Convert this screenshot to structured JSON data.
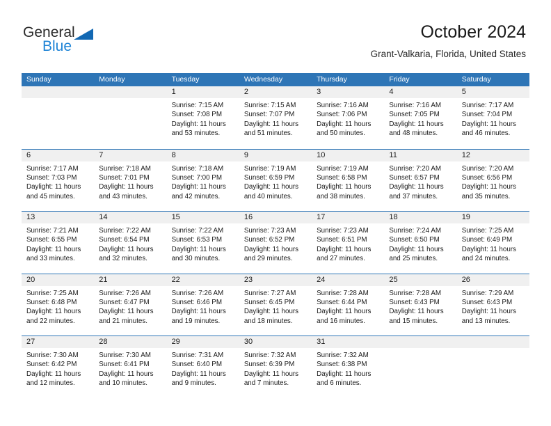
{
  "brand": {
    "name_top": "General",
    "name_bottom": "Blue",
    "accent_color": "#1f84d6",
    "triangle_color": "#1268b3"
  },
  "header": {
    "title": "October 2024",
    "subtitle": "Grant-Valkaria, Florida, United States"
  },
  "calendar": {
    "header_bg": "#2e75b6",
    "daynum_bg": "#f0f0f0",
    "weekdays": [
      "Sunday",
      "Monday",
      "Tuesday",
      "Wednesday",
      "Thursday",
      "Friday",
      "Saturday"
    ],
    "weeks": [
      [
        {
          "day": "",
          "empty": true,
          "lines": []
        },
        {
          "day": "",
          "empty": true,
          "lines": []
        },
        {
          "day": "1",
          "lines": [
            "Sunrise: 7:15 AM",
            "Sunset: 7:08 PM",
            "Daylight: 11 hours",
            "and 53 minutes."
          ]
        },
        {
          "day": "2",
          "lines": [
            "Sunrise: 7:15 AM",
            "Sunset: 7:07 PM",
            "Daylight: 11 hours",
            "and 51 minutes."
          ]
        },
        {
          "day": "3",
          "lines": [
            "Sunrise: 7:16 AM",
            "Sunset: 7:06 PM",
            "Daylight: 11 hours",
            "and 50 minutes."
          ]
        },
        {
          "day": "4",
          "lines": [
            "Sunrise: 7:16 AM",
            "Sunset: 7:05 PM",
            "Daylight: 11 hours",
            "and 48 minutes."
          ]
        },
        {
          "day": "5",
          "lines": [
            "Sunrise: 7:17 AM",
            "Sunset: 7:04 PM",
            "Daylight: 11 hours",
            "and 46 minutes."
          ]
        }
      ],
      [
        {
          "day": "6",
          "lines": [
            "Sunrise: 7:17 AM",
            "Sunset: 7:03 PM",
            "Daylight: 11 hours",
            "and 45 minutes."
          ]
        },
        {
          "day": "7",
          "lines": [
            "Sunrise: 7:18 AM",
            "Sunset: 7:01 PM",
            "Daylight: 11 hours",
            "and 43 minutes."
          ]
        },
        {
          "day": "8",
          "lines": [
            "Sunrise: 7:18 AM",
            "Sunset: 7:00 PM",
            "Daylight: 11 hours",
            "and 42 minutes."
          ]
        },
        {
          "day": "9",
          "lines": [
            "Sunrise: 7:19 AM",
            "Sunset: 6:59 PM",
            "Daylight: 11 hours",
            "and 40 minutes."
          ]
        },
        {
          "day": "10",
          "lines": [
            "Sunrise: 7:19 AM",
            "Sunset: 6:58 PM",
            "Daylight: 11 hours",
            "and 38 minutes."
          ]
        },
        {
          "day": "11",
          "lines": [
            "Sunrise: 7:20 AM",
            "Sunset: 6:57 PM",
            "Daylight: 11 hours",
            "and 37 minutes."
          ]
        },
        {
          "day": "12",
          "lines": [
            "Sunrise: 7:20 AM",
            "Sunset: 6:56 PM",
            "Daylight: 11 hours",
            "and 35 minutes."
          ]
        }
      ],
      [
        {
          "day": "13",
          "lines": [
            "Sunrise: 7:21 AM",
            "Sunset: 6:55 PM",
            "Daylight: 11 hours",
            "and 33 minutes."
          ]
        },
        {
          "day": "14",
          "lines": [
            "Sunrise: 7:22 AM",
            "Sunset: 6:54 PM",
            "Daylight: 11 hours",
            "and 32 minutes."
          ]
        },
        {
          "day": "15",
          "lines": [
            "Sunrise: 7:22 AM",
            "Sunset: 6:53 PM",
            "Daylight: 11 hours",
            "and 30 minutes."
          ]
        },
        {
          "day": "16",
          "lines": [
            "Sunrise: 7:23 AM",
            "Sunset: 6:52 PM",
            "Daylight: 11 hours",
            "and 29 minutes."
          ]
        },
        {
          "day": "17",
          "lines": [
            "Sunrise: 7:23 AM",
            "Sunset: 6:51 PM",
            "Daylight: 11 hours",
            "and 27 minutes."
          ]
        },
        {
          "day": "18",
          "lines": [
            "Sunrise: 7:24 AM",
            "Sunset: 6:50 PM",
            "Daylight: 11 hours",
            "and 25 minutes."
          ]
        },
        {
          "day": "19",
          "lines": [
            "Sunrise: 7:25 AM",
            "Sunset: 6:49 PM",
            "Daylight: 11 hours",
            "and 24 minutes."
          ]
        }
      ],
      [
        {
          "day": "20",
          "lines": [
            "Sunrise: 7:25 AM",
            "Sunset: 6:48 PM",
            "Daylight: 11 hours",
            "and 22 minutes."
          ]
        },
        {
          "day": "21",
          "lines": [
            "Sunrise: 7:26 AM",
            "Sunset: 6:47 PM",
            "Daylight: 11 hours",
            "and 21 minutes."
          ]
        },
        {
          "day": "22",
          "lines": [
            "Sunrise: 7:26 AM",
            "Sunset: 6:46 PM",
            "Daylight: 11 hours",
            "and 19 minutes."
          ]
        },
        {
          "day": "23",
          "lines": [
            "Sunrise: 7:27 AM",
            "Sunset: 6:45 PM",
            "Daylight: 11 hours",
            "and 18 minutes."
          ]
        },
        {
          "day": "24",
          "lines": [
            "Sunrise: 7:28 AM",
            "Sunset: 6:44 PM",
            "Daylight: 11 hours",
            "and 16 minutes."
          ]
        },
        {
          "day": "25",
          "lines": [
            "Sunrise: 7:28 AM",
            "Sunset: 6:43 PM",
            "Daylight: 11 hours",
            "and 15 minutes."
          ]
        },
        {
          "day": "26",
          "lines": [
            "Sunrise: 7:29 AM",
            "Sunset: 6:43 PM",
            "Daylight: 11 hours",
            "and 13 minutes."
          ]
        }
      ],
      [
        {
          "day": "27",
          "lines": [
            "Sunrise: 7:30 AM",
            "Sunset: 6:42 PM",
            "Daylight: 11 hours",
            "and 12 minutes."
          ]
        },
        {
          "day": "28",
          "lines": [
            "Sunrise: 7:30 AM",
            "Sunset: 6:41 PM",
            "Daylight: 11 hours",
            "and 10 minutes."
          ]
        },
        {
          "day": "29",
          "lines": [
            "Sunrise: 7:31 AM",
            "Sunset: 6:40 PM",
            "Daylight: 11 hours",
            "and 9 minutes."
          ]
        },
        {
          "day": "30",
          "lines": [
            "Sunrise: 7:32 AM",
            "Sunset: 6:39 PM",
            "Daylight: 11 hours",
            "and 7 minutes."
          ]
        },
        {
          "day": "31",
          "lines": [
            "Sunrise: 7:32 AM",
            "Sunset: 6:38 PM",
            "Daylight: 11 hours",
            "and 6 minutes."
          ]
        },
        {
          "day": "",
          "empty": true,
          "lines": []
        },
        {
          "day": "",
          "empty": true,
          "lines": []
        }
      ]
    ]
  }
}
